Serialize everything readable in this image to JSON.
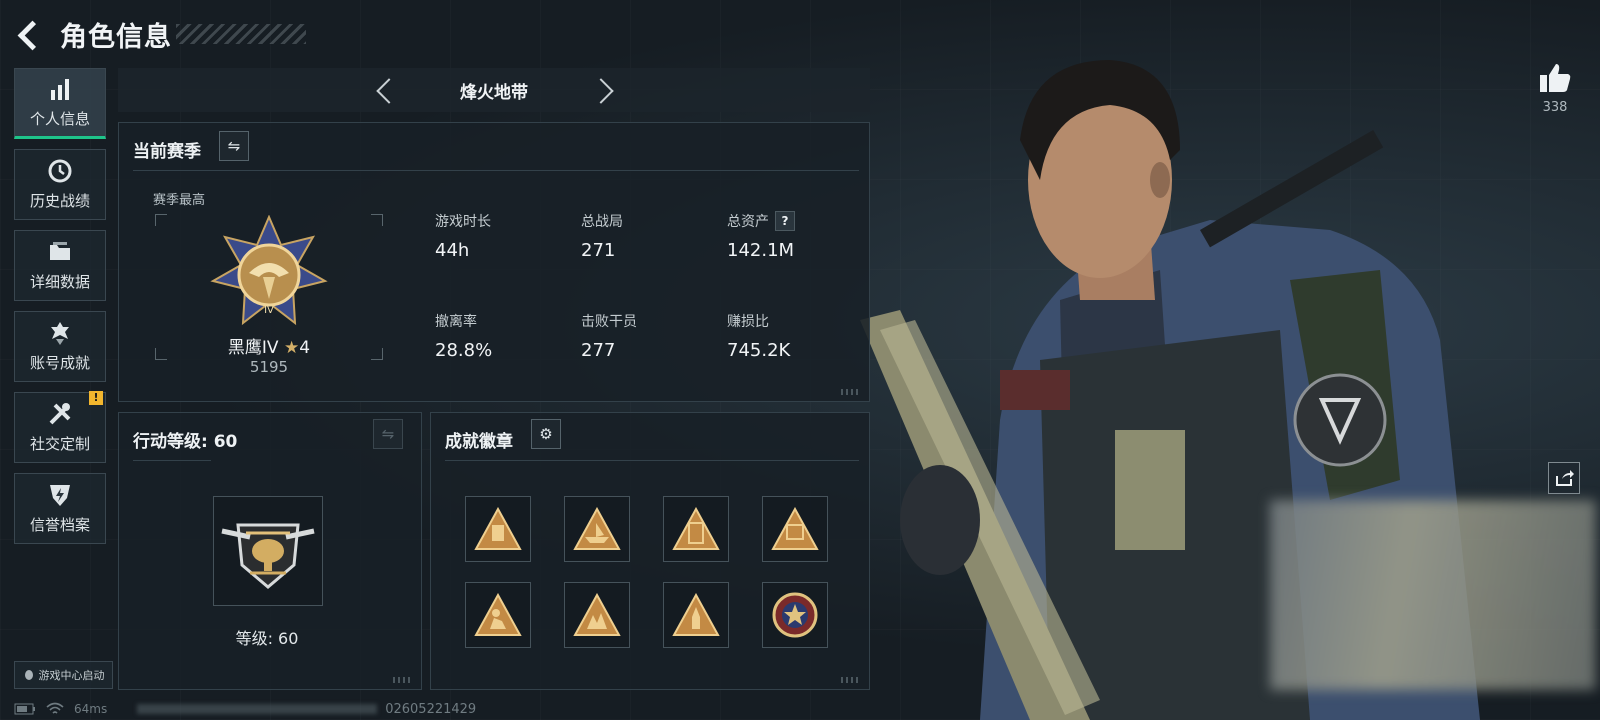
{
  "header": {
    "title": "角色信息"
  },
  "sidebar": {
    "items": [
      {
        "label": "个人信息",
        "icon": "bar-chart-icon",
        "active": true
      },
      {
        "label": "历史战绩",
        "icon": "history-icon"
      },
      {
        "label": "详细数据",
        "icon": "folder-icon"
      },
      {
        "label": "账号成就",
        "icon": "achievement-icon"
      },
      {
        "label": "社交定制",
        "icon": "tools-icon",
        "badge": "!"
      },
      {
        "label": "信誉档案",
        "icon": "shield-bolt-icon"
      }
    ],
    "game_center": "游戏中心启动"
  },
  "mode": {
    "title": "烽火地带"
  },
  "season": {
    "title": "当前赛季",
    "best_label": "赛季最高",
    "rank_name": "黑鹰IV",
    "rank_star": "★",
    "rank_stars": "4",
    "rank_score": "5195",
    "stats": [
      {
        "label": "游戏时长",
        "value": "44h"
      },
      {
        "label": "总战局",
        "value": "271"
      },
      {
        "label": "总资产",
        "value": "142.1M",
        "help": "?"
      },
      {
        "label": "撤离率",
        "value": "28.8%"
      },
      {
        "label": "击败干员",
        "value": "277"
      },
      {
        "label": "赚损比",
        "value": "745.2K"
      }
    ]
  },
  "action_level": {
    "title": "行动等级: 60",
    "level_text": "等级: 60"
  },
  "achievements": {
    "title": "成就徽章"
  },
  "likes": {
    "count": "338"
  },
  "status": {
    "ping": "64ms",
    "uid": "02605221429"
  },
  "colors": {
    "accent": "#1ec48a",
    "gold": "#d4b068",
    "warn": "#f2b62e"
  }
}
